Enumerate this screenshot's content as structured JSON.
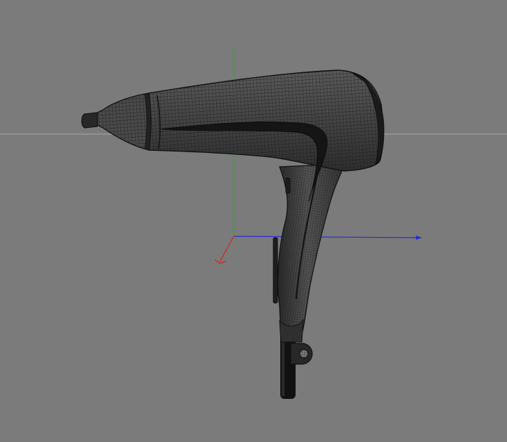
{
  "viewport": {
    "background_color": "#7b7b7b",
    "horizon_line_color": "#a8a8a8"
  },
  "axes": {
    "x_axis_color": "#2b2bd0",
    "y_axis_color": "#1db51d",
    "z_axis_color": "#d42020"
  },
  "model": {
    "wire_color": "#1a1a1a",
    "shade_dark": "#262626",
    "shade_mid": "#3c3c3c",
    "shade_light": "#606060",
    "cord_color": "#111111"
  }
}
